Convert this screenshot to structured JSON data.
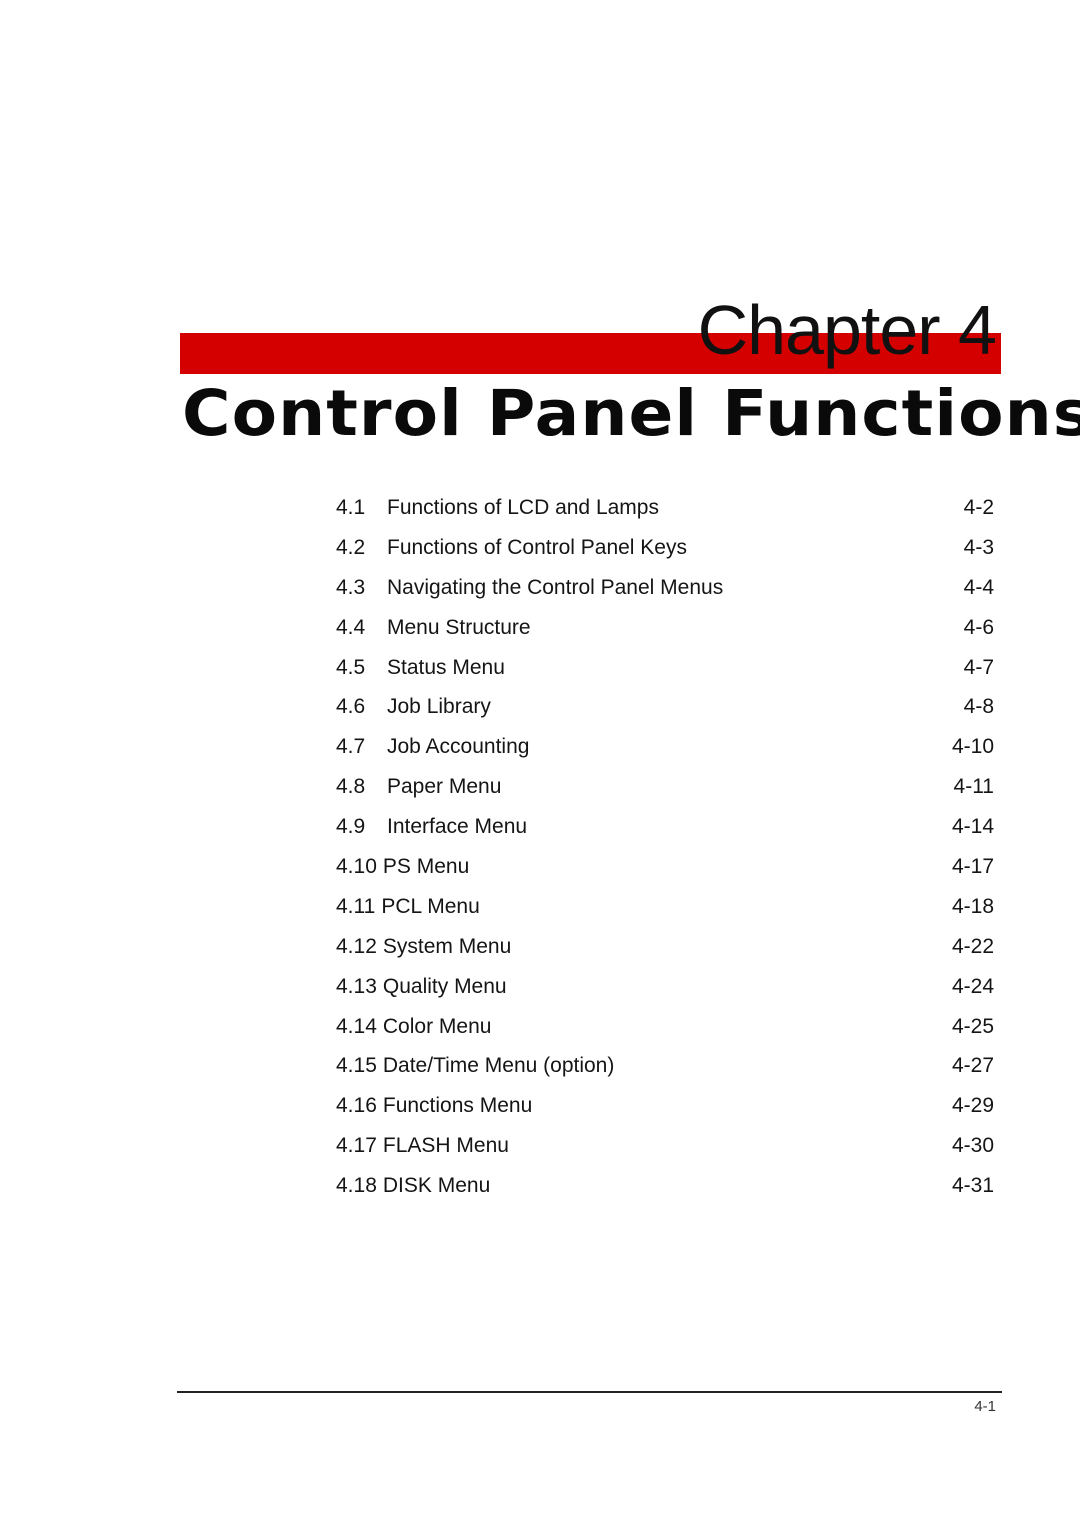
{
  "header": {
    "chapter_label": "Chapter 4",
    "chapter_title": "Control Panel Functions",
    "accent_color": "#d40000"
  },
  "toc": [
    {
      "num": "4.1",
      "title": "Functions of LCD and Lamps",
      "page": "4-2"
    },
    {
      "num": "4.2",
      "title": "Functions of Control Panel Keys",
      "page": "4-3"
    },
    {
      "num": "4.3",
      "title": "Navigating the Control Panel Menus",
      "page": "4-4"
    },
    {
      "num": "4.4",
      "title": "Menu Structure",
      "page": "4-6"
    },
    {
      "num": "4.5",
      "title": "Status Menu",
      "page": "4-7"
    },
    {
      "num": "4.6",
      "title": "Job Library",
      "page": "4-8"
    },
    {
      "num": "4.7",
      "title": "Job Accounting",
      "page": "4-10"
    },
    {
      "num": "4.8",
      "title": "Paper Menu",
      "page": "4-11"
    },
    {
      "num": "4.9",
      "title": "Interface Menu",
      "page": "4-14"
    },
    {
      "num": "4.10",
      "title": "PS Menu",
      "page": "4-17"
    },
    {
      "num": "4.11",
      "title": "PCL Menu",
      "page": "4-18"
    },
    {
      "num": "4.12",
      "title": "System Menu",
      "page": "4-22"
    },
    {
      "num": "4.13",
      "title": "Quality Menu",
      "page": "4-24"
    },
    {
      "num": "4.14",
      "title": "Color Menu",
      "page": "4-25"
    },
    {
      "num": "4.15",
      "title": "Date/Time Menu (option)",
      "page": "4-27"
    },
    {
      "num": "4.16",
      "title": "Functions Menu",
      "page": "4-29"
    },
    {
      "num": "4.17",
      "title": "FLASH Menu",
      "page": "4-30"
    },
    {
      "num": "4.18",
      "title": "DISK Menu",
      "page": "4-31"
    }
  ],
  "footer": {
    "page_number": "4-1"
  }
}
